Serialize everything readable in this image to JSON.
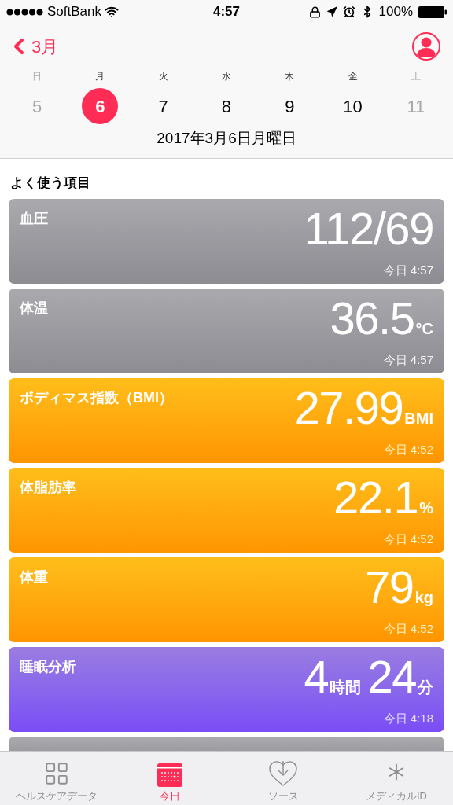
{
  "status_bar": {
    "carrier": "SoftBank",
    "time": "4:57",
    "battery": "100%"
  },
  "nav": {
    "back": "3月"
  },
  "week": [
    {
      "weekday": "日",
      "day": "5",
      "selected": false,
      "dimmed": true
    },
    {
      "weekday": "月",
      "day": "6",
      "selected": true,
      "dimmed": false
    },
    {
      "weekday": "火",
      "day": "7",
      "selected": false,
      "dimmed": false
    },
    {
      "weekday": "水",
      "day": "8",
      "selected": false,
      "dimmed": false
    },
    {
      "weekday": "木",
      "day": "9",
      "selected": false,
      "dimmed": false
    },
    {
      "weekday": "金",
      "day": "10",
      "selected": false,
      "dimmed": false
    },
    {
      "weekday": "土",
      "day": "11",
      "selected": false,
      "dimmed": true
    }
  ],
  "date_label": "2017年3月6日月曜日",
  "section_title": "よく使う項目",
  "cards": [
    {
      "kind": "gray",
      "title": "血圧",
      "value": [
        {
          "number": "112/69"
        }
      ],
      "time": "今日 4:57"
    },
    {
      "kind": "gray",
      "title": "体温",
      "value": [
        {
          "number": "36.5",
          "unit": "°C"
        }
      ],
      "time": "今日 4:57"
    },
    {
      "kind": "orange",
      "title": "ボディマス指数（BMI）",
      "value": [
        {
          "number": "27.99",
          "unit": "BMI"
        }
      ],
      "time": "今日 4:52"
    },
    {
      "kind": "orange",
      "title": "体脂肪率",
      "value": [
        {
          "number": "22.1",
          "unit": "%"
        }
      ],
      "time": "今日 4:52"
    },
    {
      "kind": "orange",
      "title": "体重",
      "value": [
        {
          "number": "79",
          "unit": "kg"
        }
      ],
      "time": "今日 4:52"
    },
    {
      "kind": "purple",
      "title": "睡眠分析",
      "value": [
        {
          "number": "4",
          "unit": "時間"
        },
        {
          "number": "24",
          "unit": "分"
        }
      ],
      "time": "今日 4:18"
    },
    {
      "kind": "gray"
    }
  ],
  "tabs": [
    {
      "kind": "grid",
      "label": "ヘルスケアデータ",
      "selected": false
    },
    {
      "kind": "calendar",
      "label": "今日",
      "selected": true
    },
    {
      "kind": "heart",
      "label": "ソース",
      "selected": false
    },
    {
      "kind": "asterisk",
      "label": "メディカルID",
      "selected": false
    }
  ]
}
